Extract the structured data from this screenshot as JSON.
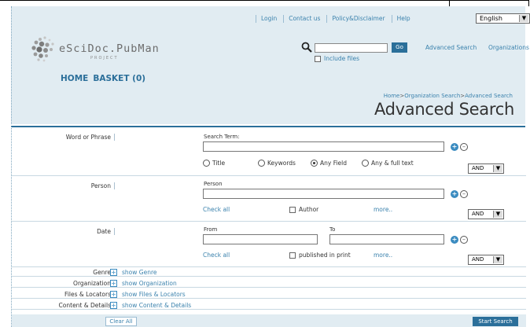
{
  "meta_menu": {
    "items": [
      "Login",
      "Contact us",
      "Policy&Disclaimer",
      "Help"
    ],
    "language": "English"
  },
  "logo": {
    "name": "eSciDoc.PubMan",
    "sub": "PROJECT"
  },
  "quick_search": {
    "query": "",
    "go_label": "Go",
    "include_files_label": "Include files",
    "advanced_link": "Advanced Search",
    "organizations_link": "Organizations"
  },
  "main_nav": {
    "home": "HOME",
    "basket": "BASKET (0)"
  },
  "breadcrumb": {
    "home": "Home",
    "org": "Organization Search",
    "current": "Advanced Search",
    "sep": ">"
  },
  "page_title": "Advanced Search",
  "word_section": {
    "label": "Word or Phrase",
    "search_term_label": "Search Term:",
    "search_term_value": "",
    "radios": [
      "Title",
      "Keywords",
      "Any Field",
      "Any & full text"
    ],
    "selected_radio": "Any Field",
    "operator": "AND"
  },
  "person_section": {
    "label": "Person",
    "field_label": "Person",
    "value": "",
    "check_all": "Check all",
    "author_label": "Author",
    "more": "more..",
    "operator": "AND"
  },
  "date_section": {
    "label": "Date",
    "from_label": "From",
    "to_label": "To",
    "from_value": "",
    "to_value": "",
    "check_all": "Check all",
    "published_label": "published in print",
    "more": "more..",
    "operator": "AND"
  },
  "toggles": [
    {
      "label": "Genre",
      "link": "show Genre"
    },
    {
      "label": "Organization",
      "link": "show Organization"
    },
    {
      "label": "Files & Locators",
      "link": "show Files & Locators"
    },
    {
      "label": "Content & Details",
      "link": "show Content & Details"
    }
  ],
  "actions": {
    "clear_all": "Clear All",
    "start_search": "Start Search"
  },
  "colors": {
    "header_bg": "#e1ecf2",
    "accent": "#2b6f9a",
    "link": "#3b82ad"
  }
}
